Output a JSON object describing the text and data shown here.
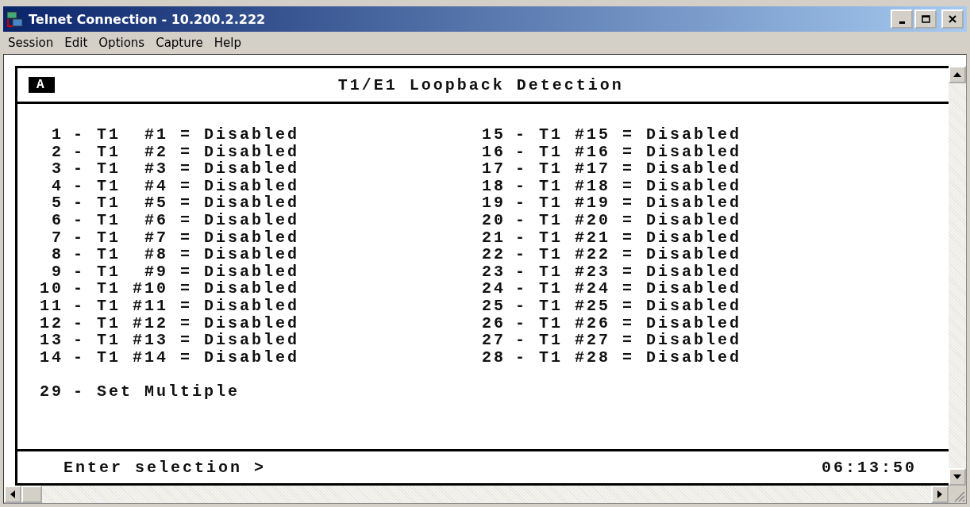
{
  "window": {
    "title": "Telnet Connection - 10.200.2.222"
  },
  "menu": [
    "Session",
    "Edit",
    "Options",
    "Capture",
    "Help"
  ],
  "terminal": {
    "badge": "A",
    "title": "T1/E1 Loopback Detection",
    "columns": [
      [
        {
          "number": "1",
          "text": "- T1  #1 = Disabled"
        },
        {
          "number": "2",
          "text": "- T1  #2 = Disabled"
        },
        {
          "number": "3",
          "text": "- T1  #3 = Disabled"
        },
        {
          "number": "4",
          "text": "- T1  #4 = Disabled"
        },
        {
          "number": "5",
          "text": "- T1  #5 = Disabled"
        },
        {
          "number": "6",
          "text": "- T1  #6 = Disabled"
        },
        {
          "number": "7",
          "text": "- T1  #7 = Disabled"
        },
        {
          "number": "8",
          "text": "- T1  #8 = Disabled"
        },
        {
          "number": "9",
          "text": "- T1  #9 = Disabled"
        },
        {
          "number": "10",
          "text": "- T1 #10 = Disabled"
        },
        {
          "number": "11",
          "text": "- T1 #11 = Disabled"
        },
        {
          "number": "12",
          "text": "- T1 #12 = Disabled"
        },
        {
          "number": "13",
          "text": "- T1 #13 = Disabled"
        },
        {
          "number": "14",
          "text": "- T1 #14 = Disabled"
        }
      ],
      [
        {
          "number": "15",
          "text": "- T1 #15 = Disabled"
        },
        {
          "number": "16",
          "text": "- T1 #16 = Disabled"
        },
        {
          "number": "17",
          "text": "- T1 #17 = Disabled"
        },
        {
          "number": "18",
          "text": "- T1 #18 = Disabled"
        },
        {
          "number": "19",
          "text": "- T1 #19 = Disabled"
        },
        {
          "number": "20",
          "text": "- T1 #20 = Disabled"
        },
        {
          "number": "21",
          "text": "- T1 #21 = Disabled"
        },
        {
          "number": "22",
          "text": "- T1 #22 = Disabled"
        },
        {
          "number": "23",
          "text": "- T1 #23 = Disabled"
        },
        {
          "number": "24",
          "text": "- T1 #24 = Disabled"
        },
        {
          "number": "25",
          "text": "- T1 #25 = Disabled"
        },
        {
          "number": "26",
          "text": "- T1 #26 = Disabled"
        },
        {
          "number": "27",
          "text": "- T1 #27 = Disabled"
        },
        {
          "number": "28",
          "text": "- T1 #28 = Disabled"
        }
      ]
    ],
    "extra": {
      "number": "29",
      "text": "- Set Multiple"
    },
    "prompt": "Enter selection >",
    "clock": "06:13:50"
  }
}
